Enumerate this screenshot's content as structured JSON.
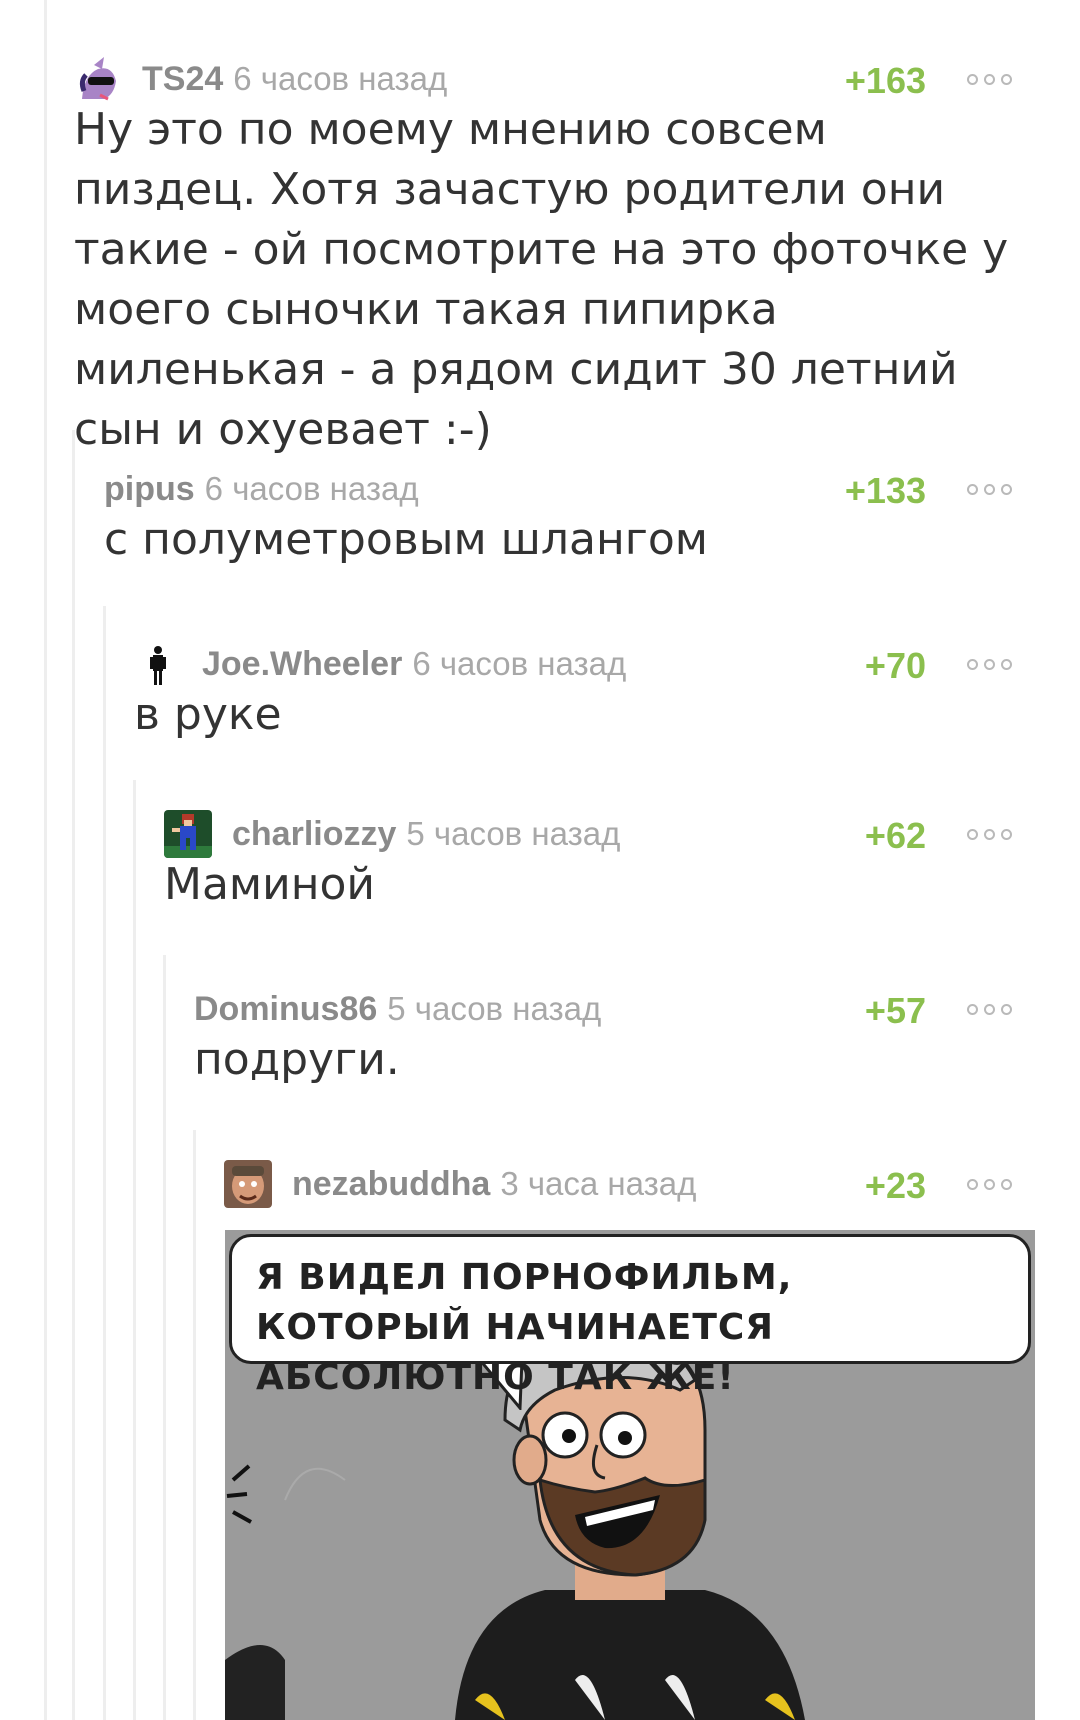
{
  "comments": [
    {
      "user": "TS24",
      "time": "6 часов назад",
      "rating": "+163",
      "text": "Ну это по моему мнению совсем пиздец. Хотя зачастую родители они такие - ой посмотрите на это фоточке у моего сыночки такая пипирка миленькая - а рядом сидит 30 летний сын и охуевает :-)"
    },
    {
      "user": "pipus",
      "time": "6 часов назад",
      "rating": "+133",
      "text": "с полуметровым шлангом"
    },
    {
      "user": "Joe.Wheeler",
      "time": "6 часов назад",
      "rating": "+70",
      "text": "в руке"
    },
    {
      "user": "charliozzy",
      "time": "5 часов назад",
      "rating": "+62",
      "text": "Маминой"
    },
    {
      "user": "Dominus86",
      "time": "5 часов назад",
      "rating": "+57",
      "text": "подруги."
    },
    {
      "user": "nezabuddha",
      "time": "3 часа назад",
      "rating": "+23",
      "text": ""
    }
  ],
  "comic": {
    "speech": "Я ВИДЕЛ ПОРНОФИЛЬМ, КОТОРЫЙ НАЧИНАЕТСЯ АБСОЛЮТНО ТАК ЖЕ!"
  },
  "icons": [
    "pony-avatar-icon",
    "person-icon",
    "pixel-character-avatar-icon",
    "cartoon-face-avatar-icon",
    "more-options-icon"
  ],
  "colors": {
    "rating": "#8bbf4e",
    "username": "#8a8a8a",
    "time": "#a8a8a8",
    "thread_line": "#eeeeee"
  }
}
